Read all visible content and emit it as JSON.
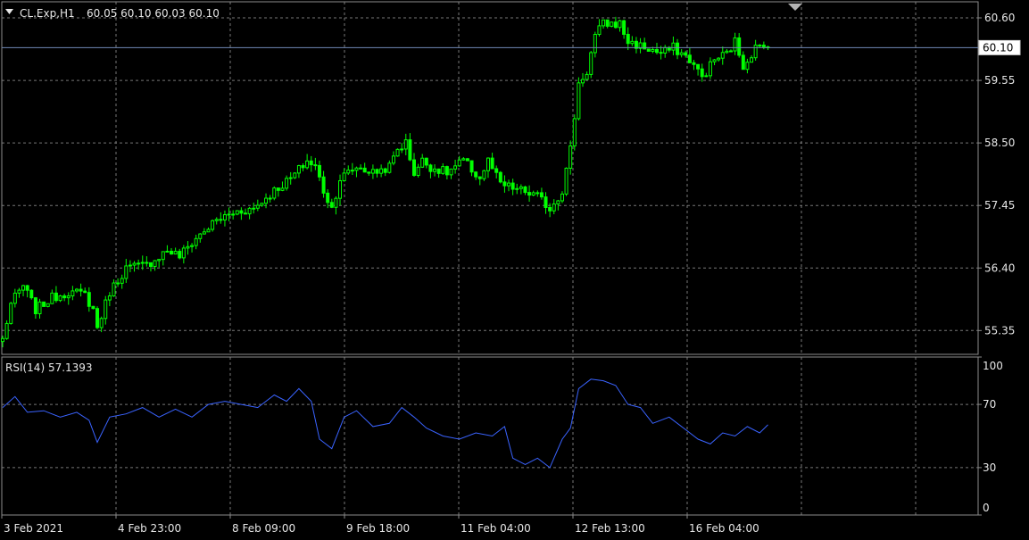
{
  "header": {
    "symbol_label": "CL.Exp,H1",
    "ohlc_label": "60.05 60.10 60.03 60.10"
  },
  "price_panel": {
    "yticks": [
      "60.60",
      "59.55",
      "58.50",
      "57.45",
      "56.40",
      "55.35"
    ],
    "current_price": "60.10"
  },
  "rsi_panel": {
    "label": "RSI(14) 57.1393",
    "levels": [
      "100",
      "70",
      "30",
      "0"
    ]
  },
  "x_axis": {
    "labels": [
      "3 Feb 2021",
      "4 Feb 23:00",
      "8 Feb 09:00",
      "9 Feb 18:00",
      "11 Feb 04:00",
      "12 Feb 13:00",
      "16 Feb 04:00"
    ]
  },
  "colors": {
    "background": "#000000",
    "grid": "#8c8c8c",
    "candle": "#00ff00",
    "rsi_line": "#3a63ff",
    "price_line": "#6f88b4",
    "text": "#e6e6e6"
  },
  "chart_data": [
    {
      "type": "candlestick",
      "title": "CL.Exp,H1",
      "timeframe": "H1",
      "last_ohlc": {
        "open": 60.05,
        "high": 60.1,
        "low": 60.03,
        "close": 60.1
      },
      "ylim": [
        54.95,
        60.87
      ],
      "current_price": 60.1,
      "close_path": [
        [
          0,
          55.2
        ],
        [
          2,
          55.8
        ],
        [
          5,
          56.1
        ],
        [
          8,
          55.7
        ],
        [
          12,
          55.9
        ],
        [
          16,
          56.0
        ],
        [
          20,
          55.95
        ],
        [
          22,
          55.7
        ],
        [
          23,
          55.4
        ],
        [
          26,
          56.0
        ],
        [
          30,
          56.4
        ],
        [
          35,
          56.45
        ],
        [
          40,
          56.7
        ],
        [
          43,
          56.6
        ],
        [
          47,
          56.9
        ],
        [
          52,
          57.2
        ],
        [
          57,
          57.35
        ],
        [
          61,
          57.4
        ],
        [
          66,
          57.7
        ],
        [
          70,
          57.9
        ],
        [
          74,
          58.2
        ],
        [
          76,
          58.1
        ],
        [
          78,
          57.7
        ],
        [
          80,
          57.4
        ],
        [
          82,
          57.9
        ],
        [
          86,
          58.1
        ],
        [
          90,
          58.0
        ],
        [
          94,
          58.1
        ],
        [
          96,
          58.4
        ],
        [
          98,
          58.5
        ],
        [
          100,
          58.0
        ],
        [
          102,
          58.2
        ],
        [
          104,
          58.1
        ],
        [
          108,
          58.0
        ],
        [
          112,
          58.2
        ],
        [
          116,
          57.9
        ],
        [
          118,
          58.2
        ],
        [
          121,
          57.8
        ],
        [
          126,
          57.7
        ],
        [
          130,
          57.6
        ],
        [
          133,
          57.4
        ],
        [
          136,
          57.7
        ],
        [
          138,
          58.4
        ],
        [
          140,
          59.5
        ],
        [
          142,
          59.7
        ],
        [
          144,
          60.3
        ],
        [
          146,
          60.5
        ],
        [
          150,
          60.5
        ],
        [
          152,
          60.2
        ],
        [
          156,
          60.1
        ],
        [
          160,
          60.0
        ],
        [
          163,
          60.1
        ],
        [
          167,
          59.9
        ],
        [
          170,
          59.6
        ],
        [
          173,
          59.9
        ],
        [
          176,
          60.0
        ],
        [
          178,
          60.2
        ],
        [
          180,
          59.8
        ],
        [
          183,
          60.1
        ],
        [
          186,
          60.1
        ]
      ]
    },
    {
      "type": "line",
      "title": "RSI(14) 57.1393",
      "last_value": 57.1393,
      "ylim": [
        0,
        100
      ],
      "levels": [
        70,
        30
      ],
      "x": [
        0,
        3,
        6,
        10,
        14,
        18,
        21,
        23,
        26,
        30,
        34,
        38,
        42,
        46,
        50,
        54,
        58,
        62,
        66,
        69,
        72,
        75,
        77,
        80,
        83,
        86,
        90,
        94,
        97,
        100,
        103,
        107,
        111,
        115,
        119,
        122,
        124,
        127,
        130,
        133,
        136,
        138,
        140,
        143,
        146,
        149,
        152,
        155,
        158,
        162,
        166,
        169,
        172,
        175,
        178,
        181,
        184,
        186
      ],
      "values": [
        68,
        75,
        65,
        66,
        62,
        65,
        60,
        46,
        62,
        64,
        68,
        62,
        67,
        62,
        70,
        72,
        70,
        68,
        76,
        72,
        80,
        72,
        48,
        42,
        62,
        66,
        56,
        58,
        68,
        62,
        55,
        50,
        48,
        52,
        50,
        56,
        36,
        32,
        36,
        30,
        48,
        55,
        80,
        86,
        85,
        82,
        70,
        68,
        58,
        62,
        54,
        48,
        45,
        52,
        50,
        56,
        52,
        57.14
      ]
    }
  ]
}
